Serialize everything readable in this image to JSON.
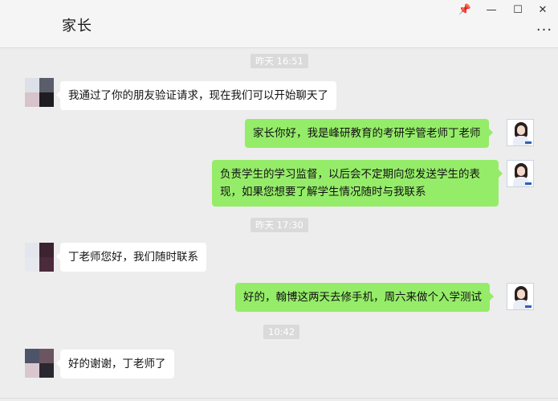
{
  "header": {
    "title": "家长",
    "pin_icon": "📌",
    "min_icon": "—",
    "max_icon": "☐",
    "close_icon": "✕",
    "more_icon": "···"
  },
  "timestamps": [
    "昨天 16:51",
    "昨天 17:30",
    "10:42"
  ],
  "messages": [
    {
      "side": "left",
      "text": "我通过了你的朋友验证请求，现在我们可以开始聊天了"
    },
    {
      "side": "right",
      "text": "家长你好，我是峰研教育的考研学管老师丁老师"
    },
    {
      "side": "right",
      "line1": "负责学生的学习监督，以后会不定期向您发送学生的表",
      "line2": "现，如果您想要了解学生情况随时与我联系"
    },
    {
      "side": "left",
      "text": "丁老师您好，我们随时联系"
    },
    {
      "side": "right",
      "text": "好的，翰博这两天去修手机，周六来做个入学测试"
    },
    {
      "side": "left",
      "text": "好的谢谢，丁老师了"
    }
  ],
  "colors": {
    "background": "#ededed",
    "bubble_self": "#95ec69",
    "bubble_other": "#ffffff",
    "timestamp_bg": "#dadada"
  }
}
